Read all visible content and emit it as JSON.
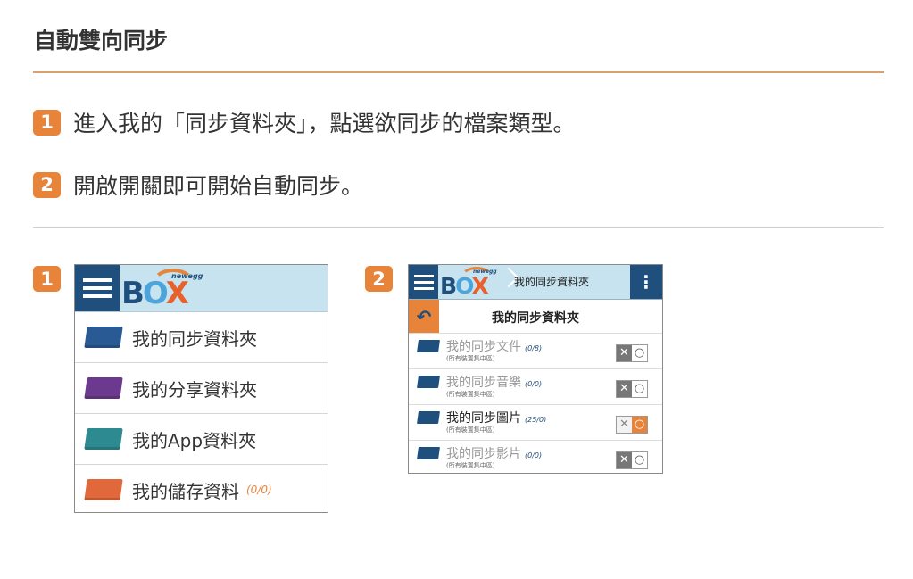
{
  "title": "自動雙向同步",
  "steps": [
    {
      "num": "1",
      "text": "進入我的「同步資料夾」，點選欲同步的檔案類型。"
    },
    {
      "num": "2",
      "text": "開啟開關即可開始自動同步。"
    }
  ],
  "shots": [
    {
      "badge": "1",
      "logo": {
        "b": "B",
        "o": "O",
        "x": "X",
        "brand": "newegg"
      },
      "rows": [
        {
          "label": "我的同步資料夾",
          "count": "",
          "color": "#2a5a93"
        },
        {
          "label": "我的分享資料夾",
          "count": "",
          "color": "#6b3a8e"
        },
        {
          "label": "我的App資料夾",
          "count": "",
          "color": "#2e8a91"
        },
        {
          "label": "我的儲存資料",
          "count": "(0/0)",
          "color": "#e0683a"
        }
      ]
    },
    {
      "badge": "2",
      "logo": {
        "b": "B",
        "o": "O",
        "x": "X",
        "brand": "newegg"
      },
      "breadcrumb": "我的同步資料夾",
      "menu_glyph": "⋮",
      "back_glyph": "↶",
      "subtitle": "我的同步資料夾",
      "rows": [
        {
          "label": "我的同步文件",
          "count": "(0/8)",
          "sub": "(所有裝置集中區)",
          "on": false
        },
        {
          "label": "我的同步音樂",
          "count": "(0/0)",
          "sub": "(所有裝置集中區)",
          "on": false
        },
        {
          "label": "我的同步圖片",
          "count": "(25/0)",
          "sub": "(所有裝置集中區)",
          "on": true
        },
        {
          "label": "我的同步影片",
          "count": "(0/0)",
          "sub": "(所有裝置集中區)",
          "on": false
        }
      ],
      "toggle": {
        "off": "✕",
        "on": "○"
      }
    }
  ]
}
